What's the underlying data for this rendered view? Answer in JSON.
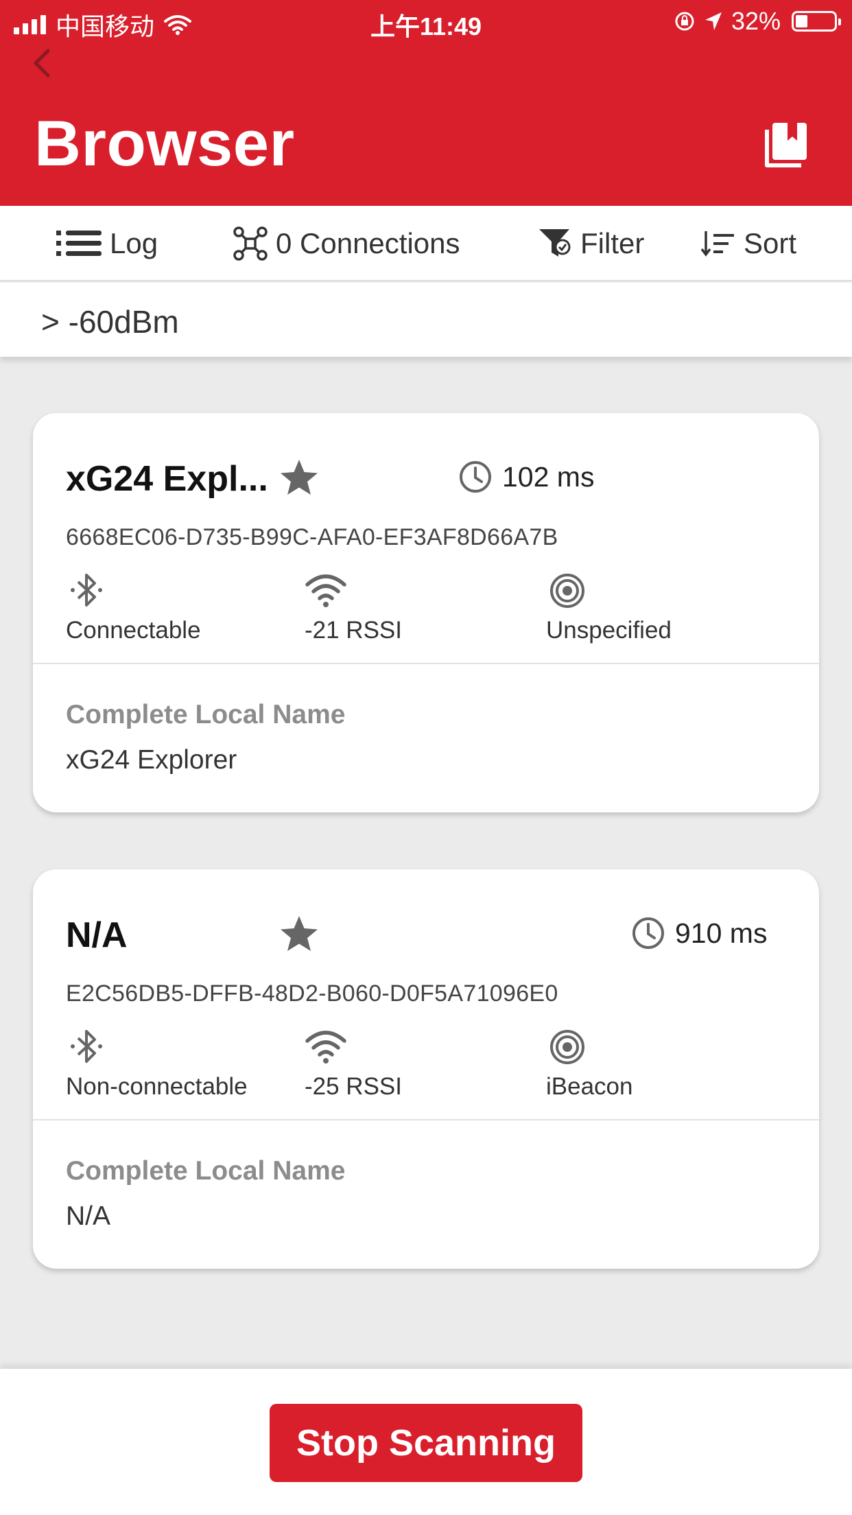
{
  "status_bar": {
    "carrier": "中国移动",
    "time": "上午11:49",
    "battery": "32%",
    "battery_level": 0.32
  },
  "header": {
    "title": "Browser"
  },
  "toolbar": {
    "log_label": "Log",
    "connections_label": "0 Connections",
    "filter_label": "Filter",
    "sort_label": "Sort"
  },
  "filter": {
    "active_filter": "> -60dBm"
  },
  "devices": [
    {
      "name": "xG24 Expl...",
      "favorite": false,
      "interval": "102 ms",
      "uuid": "6668EC06-D735-B99C-AFA0-EF3AF8D66A7B",
      "connectable": "Connectable",
      "rssi": "-21 RSSI",
      "beacon_type": "Unspecified",
      "ad_title": "Complete Local Name",
      "ad_value": "xG24 Explorer"
    },
    {
      "name": "N/A",
      "favorite": false,
      "interval": "910 ms",
      "uuid": "E2C56DB5-DFFB-48D2-B060-D0F5A71096E0",
      "connectable": "Non-connectable",
      "rssi": "-25 RSSI",
      "beacon_type": "iBeacon",
      "ad_title": "Complete Local Name",
      "ad_value": "N/A"
    }
  ],
  "footer": {
    "stop_label": "Stop Scanning"
  },
  "colors": {
    "brand_red": "#d91e2c",
    "icon_gray": "#666666"
  }
}
